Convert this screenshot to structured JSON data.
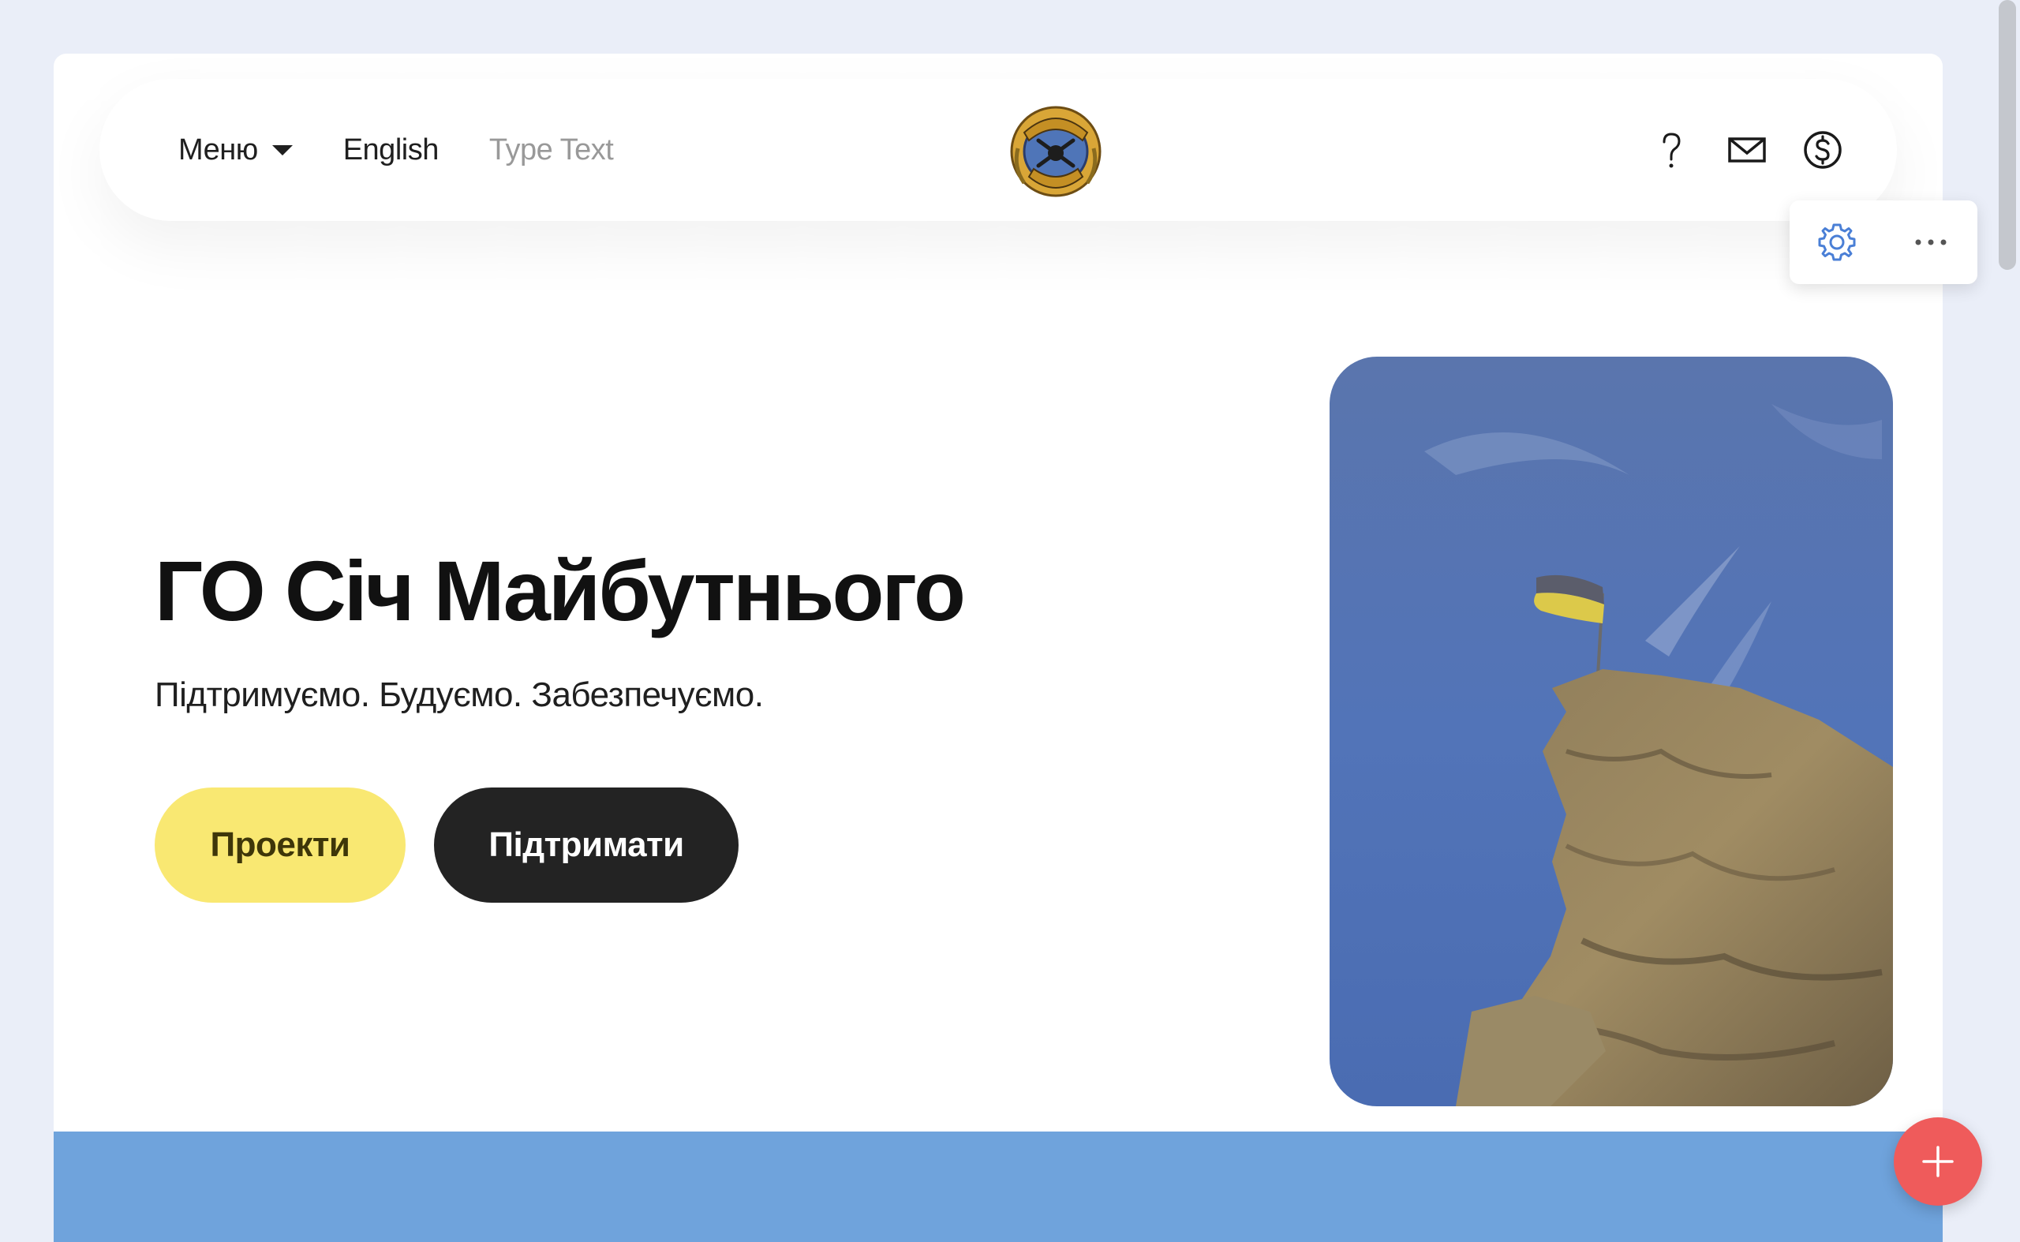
{
  "nav": {
    "menu_label": "Меню",
    "language_label": "English",
    "text_placeholder": "Type Text",
    "logo_alt": "Січ Майбутнього"
  },
  "hero": {
    "title": "ГО Січ Майбутнього",
    "subtitle": "Підтримуємо. Будуємо. Забезпечуємо.",
    "primary_button": "Проекти",
    "secondary_button": "Підтримати",
    "photo_alt": "Ukrainian flag on top of a rock against blue sky"
  },
  "icons": {
    "help": "question-mark-icon",
    "mail": "envelope-icon",
    "donate": "dollar-circle-icon",
    "settings": "gear-icon",
    "more": "more-dots-icon",
    "add": "plus-icon"
  },
  "colors": {
    "primary_button_bg": "#f9e872",
    "secondary_button_bg": "#232323",
    "band": "#6fa3dc",
    "fab": "#ef5b5b",
    "toolbar_icon": "#4a7fd6"
  }
}
